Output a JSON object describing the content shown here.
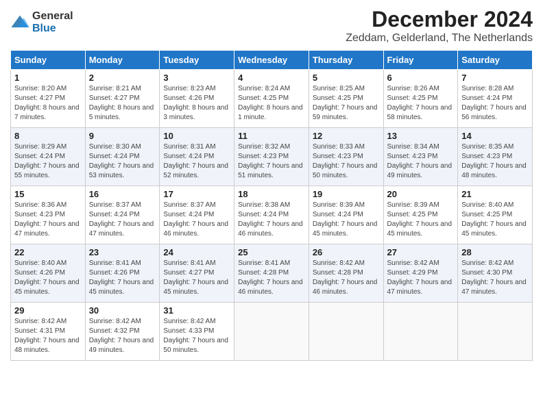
{
  "header": {
    "logo_general": "General",
    "logo_blue": "Blue",
    "month_title": "December 2024",
    "location": "Zeddam, Gelderland, The Netherlands"
  },
  "weekdays": [
    "Sunday",
    "Monday",
    "Tuesday",
    "Wednesday",
    "Thursday",
    "Friday",
    "Saturday"
  ],
  "weeks": [
    [
      {
        "day": "1",
        "sunrise": "8:20 AM",
        "sunset": "4:27 PM",
        "daylight": "8 hours and 7 minutes."
      },
      {
        "day": "2",
        "sunrise": "8:21 AM",
        "sunset": "4:27 PM",
        "daylight": "8 hours and 5 minutes."
      },
      {
        "day": "3",
        "sunrise": "8:23 AM",
        "sunset": "4:26 PM",
        "daylight": "8 hours and 3 minutes."
      },
      {
        "day": "4",
        "sunrise": "8:24 AM",
        "sunset": "4:25 PM",
        "daylight": "8 hours and 1 minute."
      },
      {
        "day": "5",
        "sunrise": "8:25 AM",
        "sunset": "4:25 PM",
        "daylight": "7 hours and 59 minutes."
      },
      {
        "day": "6",
        "sunrise": "8:26 AM",
        "sunset": "4:25 PM",
        "daylight": "7 hours and 58 minutes."
      },
      {
        "day": "7",
        "sunrise": "8:28 AM",
        "sunset": "4:24 PM",
        "daylight": "7 hours and 56 minutes."
      }
    ],
    [
      {
        "day": "8",
        "sunrise": "8:29 AM",
        "sunset": "4:24 PM",
        "daylight": "7 hours and 55 minutes."
      },
      {
        "day": "9",
        "sunrise": "8:30 AM",
        "sunset": "4:24 PM",
        "daylight": "7 hours and 53 minutes."
      },
      {
        "day": "10",
        "sunrise": "8:31 AM",
        "sunset": "4:24 PM",
        "daylight": "7 hours and 52 minutes."
      },
      {
        "day": "11",
        "sunrise": "8:32 AM",
        "sunset": "4:23 PM",
        "daylight": "7 hours and 51 minutes."
      },
      {
        "day": "12",
        "sunrise": "8:33 AM",
        "sunset": "4:23 PM",
        "daylight": "7 hours and 50 minutes."
      },
      {
        "day": "13",
        "sunrise": "8:34 AM",
        "sunset": "4:23 PM",
        "daylight": "7 hours and 49 minutes."
      },
      {
        "day": "14",
        "sunrise": "8:35 AM",
        "sunset": "4:23 PM",
        "daylight": "7 hours and 48 minutes."
      }
    ],
    [
      {
        "day": "15",
        "sunrise": "8:36 AM",
        "sunset": "4:23 PM",
        "daylight": "7 hours and 47 minutes."
      },
      {
        "day": "16",
        "sunrise": "8:37 AM",
        "sunset": "4:24 PM",
        "daylight": "7 hours and 47 minutes."
      },
      {
        "day": "17",
        "sunrise": "8:37 AM",
        "sunset": "4:24 PM",
        "daylight": "7 hours and 46 minutes."
      },
      {
        "day": "18",
        "sunrise": "8:38 AM",
        "sunset": "4:24 PM",
        "daylight": "7 hours and 46 minutes."
      },
      {
        "day": "19",
        "sunrise": "8:39 AM",
        "sunset": "4:24 PM",
        "daylight": "7 hours and 45 minutes."
      },
      {
        "day": "20",
        "sunrise": "8:39 AM",
        "sunset": "4:25 PM",
        "daylight": "7 hours and 45 minutes."
      },
      {
        "day": "21",
        "sunrise": "8:40 AM",
        "sunset": "4:25 PM",
        "daylight": "7 hours and 45 minutes."
      }
    ],
    [
      {
        "day": "22",
        "sunrise": "8:40 AM",
        "sunset": "4:26 PM",
        "daylight": "7 hours and 45 minutes."
      },
      {
        "day": "23",
        "sunrise": "8:41 AM",
        "sunset": "4:26 PM",
        "daylight": "7 hours and 45 minutes."
      },
      {
        "day": "24",
        "sunrise": "8:41 AM",
        "sunset": "4:27 PM",
        "daylight": "7 hours and 45 minutes."
      },
      {
        "day": "25",
        "sunrise": "8:41 AM",
        "sunset": "4:28 PM",
        "daylight": "7 hours and 46 minutes."
      },
      {
        "day": "26",
        "sunrise": "8:42 AM",
        "sunset": "4:28 PM",
        "daylight": "7 hours and 46 minutes."
      },
      {
        "day": "27",
        "sunrise": "8:42 AM",
        "sunset": "4:29 PM",
        "daylight": "7 hours and 47 minutes."
      },
      {
        "day": "28",
        "sunrise": "8:42 AM",
        "sunset": "4:30 PM",
        "daylight": "7 hours and 47 minutes."
      }
    ],
    [
      {
        "day": "29",
        "sunrise": "8:42 AM",
        "sunset": "4:31 PM",
        "daylight": "7 hours and 48 minutes."
      },
      {
        "day": "30",
        "sunrise": "8:42 AM",
        "sunset": "4:32 PM",
        "daylight": "7 hours and 49 minutes."
      },
      {
        "day": "31",
        "sunrise": "8:42 AM",
        "sunset": "4:33 PM",
        "daylight": "7 hours and 50 minutes."
      },
      null,
      null,
      null,
      null
    ]
  ],
  "labels": {
    "sunrise": "Sunrise:",
    "sunset": "Sunset:",
    "daylight": "Daylight:"
  }
}
